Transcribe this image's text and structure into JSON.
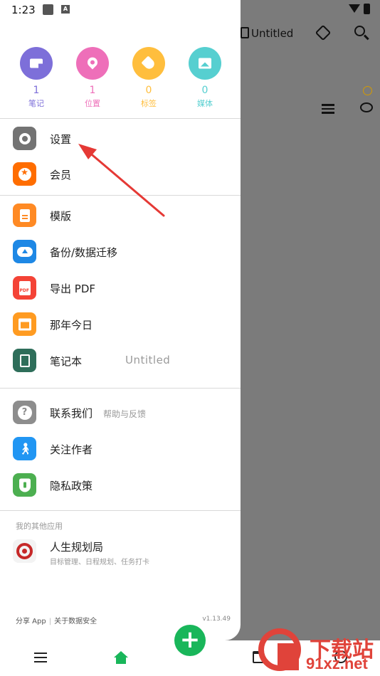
{
  "status_bar": {
    "time": "1:23",
    "app_badge": "A"
  },
  "background_app": {
    "notebook_title": "Untitled"
  },
  "stats": [
    {
      "count": "1",
      "label": "笔记",
      "color": "#7d6fd9",
      "icon": "note-icon"
    },
    {
      "count": "1",
      "label": "位置",
      "color": "#ee6fb9",
      "icon": "location-pin-icon"
    },
    {
      "count": "0",
      "label": "标签",
      "color": "#ffbe3d",
      "icon": "tag-icon"
    },
    {
      "count": "0",
      "label": "媒体",
      "color": "#56cfd0",
      "icon": "image-icon"
    }
  ],
  "menu": {
    "settings": "设置",
    "membership": "会员",
    "templates": "模版",
    "backup": "备份/数据迁移",
    "export_pdf": "导出 PDF",
    "on_this_day": "那年今日",
    "notebook": "笔记本",
    "notebook_value": "Untitled",
    "contact": "联系我们",
    "contact_sub": "帮助与反馈",
    "follow_author": "关注作者",
    "privacy": "隐私政策"
  },
  "menu_icon_colors": {
    "settings": "#737373",
    "membership": "#ff6d00",
    "templates": "#ff8a24",
    "backup": "#1e88e5",
    "export_pdf": "#f44336",
    "on_this_day": "#ff9b21",
    "notebook": "#2e6e5a",
    "contact": "#8d8d8d",
    "follow_author": "#2196f3",
    "privacy": "#4caf50"
  },
  "other_apps": {
    "section_title": "我的其他应用",
    "app_name": "人生规划局",
    "app_desc": "目标管理、日程规划、任务打卡"
  },
  "footer": {
    "share": "分享 App",
    "data_security": "关于数据安全",
    "version": "v1.13.49"
  },
  "watermark": {
    "line1": "下载站",
    "line2": "91xz.net"
  },
  "accent": "#19b65a",
  "annotation_color": "#e53935"
}
